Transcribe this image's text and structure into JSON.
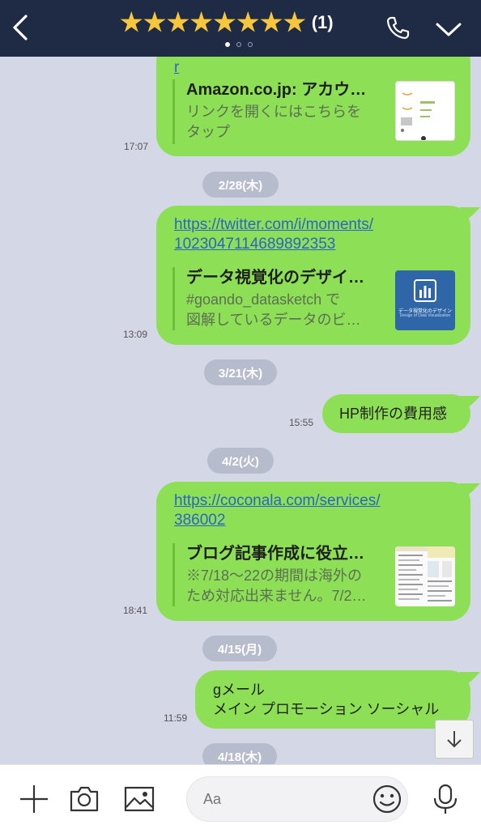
{
  "header": {
    "back_icon": "chevron-left-icon",
    "stars": "★★★★★★★★",
    "count": "(1)",
    "page_dots": 3,
    "phone_icon": "phone-icon",
    "menu_icon": "chevron-down-icon",
    "colors": {
      "bar": "#1f2a44",
      "star": "#f7c63b"
    }
  },
  "messages": [
    {
      "time": "17:07",
      "link_partial": "r",
      "preview_title": "Amazon.co.jp: アカウ…",
      "preview_desc_1": "リンクを開くにはこちらを",
      "preview_desc_2": "タップ"
    },
    {
      "date": "2/28(木)"
    },
    {
      "time": "13:09",
      "link_1": "https://twitter.com/i/moments/",
      "link_2": "1023047114689892353",
      "preview_title": "データ視覚化のデザイ…",
      "preview_desc_1": "#goando_datasketch で",
      "preview_desc_2": "図解しているデータのビ…",
      "thumb_caption_1": "データ視覚化のデザイン",
      "thumb_caption_2": "Design of Data Visualization"
    },
    {
      "date": "3/21(木)"
    },
    {
      "time": "15:55",
      "text": "HP制作の費用感"
    },
    {
      "date": "4/2(火)"
    },
    {
      "time": "18:41",
      "link_1": "https://coconala.com/services/",
      "link_2": "386002",
      "preview_title": "ブログ記事作成に役立…",
      "preview_desc_1": "※7/18〜22の期間は海外の",
      "preview_desc_2": "ため対応出来ません。7/2…"
    },
    {
      "date": "4/15(月)"
    },
    {
      "time": "11:59",
      "text_1": "gメール",
      "text_2": "メイン プロモーション ソーシャル"
    },
    {
      "date": "4/18(木)"
    }
  ],
  "footer": {
    "placeholder": "Aa",
    "icons": [
      "plus-icon",
      "camera-icon",
      "image-icon",
      "emoji-icon",
      "microphone-icon"
    ]
  },
  "scroll_button_icon": "arrow-down-icon",
  "colors": {
    "bubble": "#8de055",
    "background": "#d3d7e6",
    "date_pill": "#b7bccd",
    "link": "#2a64c9"
  }
}
